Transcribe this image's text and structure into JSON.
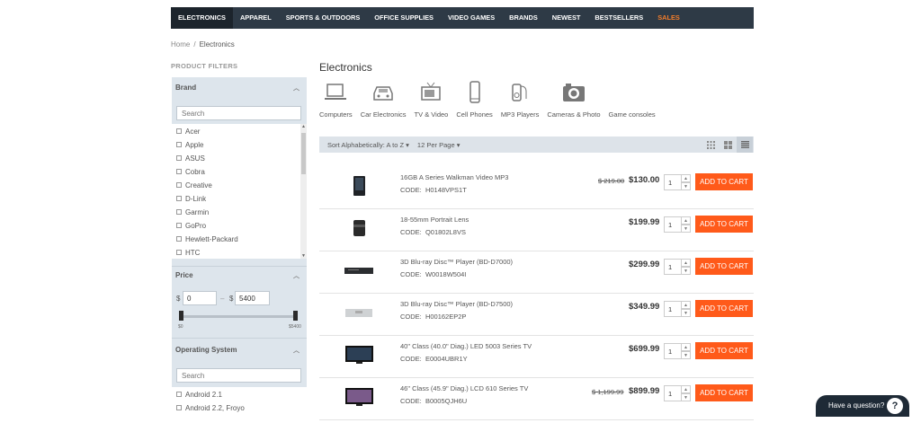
{
  "nav": [
    "ELECTRONICS",
    "APPAREL",
    "SPORTS & OUTDOORS",
    "OFFICE SUPPLIES",
    "VIDEO GAMES",
    "BRANDS",
    "NEWEST",
    "BESTSELLERS",
    "SALES"
  ],
  "breadcrumb": {
    "home": "Home",
    "sep": "/",
    "current": "Electronics"
  },
  "filters": {
    "title": "PRODUCT FILTERS",
    "brand": {
      "label": "Brand",
      "placeholder": "Search",
      "items": [
        "Acer",
        "Apple",
        "ASUS",
        "Cobra",
        "Creative",
        "D-Link",
        "Garmin",
        "GoPro",
        "Hewlett-Packard",
        "HTC"
      ]
    },
    "price": {
      "label": "Price",
      "currency": "$",
      "sep": "–",
      "min": "0",
      "max": "5400",
      "range_min": "$0",
      "range_max": "$5400"
    },
    "os": {
      "label": "Operating System",
      "placeholder": "Search",
      "items": [
        "Android 2.1",
        "Android 2.2, Froyo"
      ]
    }
  },
  "page_title": "Electronics",
  "categories": [
    "Computers",
    "Car Electronics",
    "TV & Video",
    "Cell Phones",
    "MP3 Players",
    "Cameras & Photo",
    "Game consoles"
  ],
  "toolbar": {
    "sort": "Sort Alphabetically: A to Z",
    "per_page": "12 Per Page"
  },
  "code_label": "CODE:",
  "add_label": "ADD TO CART",
  "products": [
    {
      "name": "16GB A Series Walkman Video MP3",
      "code": "H0148VPS1T",
      "old": "$ 219.00",
      "price": "$130.00",
      "qty": "1"
    },
    {
      "name": "18-55mm Portrait Lens",
      "code": "Q01802L8VS",
      "old": "",
      "price": "$199.99",
      "qty": "1"
    },
    {
      "name": "3D Blu-ray Disc™ Player (BD-D7000)",
      "code": "W0018W504I",
      "old": "",
      "price": "$299.99",
      "qty": "1"
    },
    {
      "name": "3D Blu-ray Disc™ Player (BD-D7500)",
      "code": "H00162EP2P",
      "old": "",
      "price": "$349.99",
      "qty": "1"
    },
    {
      "name": "40\" Class (40.0\" Diag.) LED 5003 Series TV",
      "code": "E0004UBR1Y",
      "old": "",
      "price": "$699.99",
      "qty": "1"
    },
    {
      "name": "46\" Class (45.9\" Diag.) LCD 610 Series TV",
      "code": "B0005QJH6U",
      "old": "$ 1,199.99",
      "price": "$899.99",
      "qty": "1"
    }
  ],
  "help": "Have a question?",
  "help_icon": "?",
  "colors": {
    "nav_bg": "#2e3a46",
    "sale": "#f47d2a",
    "add_to_cart": "#ff5a1a",
    "sidebar": "#dde5ec"
  }
}
